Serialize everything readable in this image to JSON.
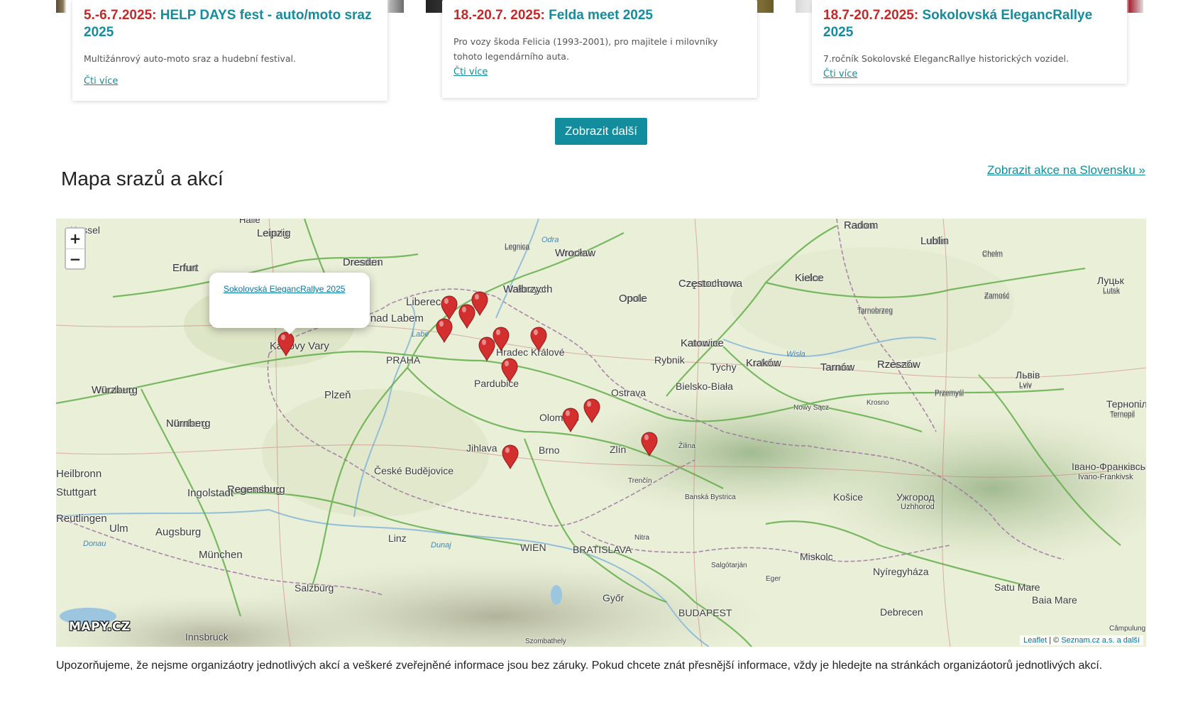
{
  "cards": [
    {
      "date": "5.-6.7.2025:",
      "name": "HELP DAYS fest - auto/moto sraz 2025",
      "desc": "Multižánrový auto-moto sraz a hudební festival.",
      "more": "Čti více"
    },
    {
      "date": "18.-20.7. 2025:",
      "name": "Felda meet 2025",
      "desc": "Pro vozy škoda Felicia (1993-2001), pro majitele i milovníky tohoto legendárního auta.",
      "more": "Čti více"
    },
    {
      "date": "18.7-20.7.2025:",
      "name": "Sokolovská EleganсRallye 2025",
      "desc": "7.ročník Sokolovské EleganсRallye historických vozidel.",
      "more": "Čti více"
    }
  ],
  "more_button": "Zobrazit další",
  "section": {
    "title": "Mapa srazů a akcí",
    "slovakia_link": "Zobrazit akce na Slovensku »"
  },
  "map": {
    "zoom_in": "+",
    "zoom_out": "−",
    "popup_link": "Sokolovská EleganсRallye 2025",
    "attribution_leaflet": "Leaflet",
    "attribution_sep": " | © ",
    "attribution_source": "Seznam.cz a.s. a další",
    "logo": "MAPY.CZ",
    "marker_color": "#d32f2f",
    "road_color": "#5cab43",
    "cities": [
      "Halle",
      "Leipzig",
      "Dresden",
      "Erfurt",
      "Legnica",
      "Wrocław",
      "Wałbrzych",
      "Opole",
      "Częstochowa",
      "Kielce",
      "Radom",
      "Lublin",
      "Chełm",
      "Луцьк",
      "Lutsk",
      "Zamość",
      "Tarnobrzeg",
      "Katowice",
      "Kraków",
      "Tarnów",
      "Rzeszów",
      "Przemyśl",
      "Львів",
      "Lviv",
      "Тернопіль",
      "Ternopil",
      "Würzburg",
      "Nürnberg",
      "Regensburg",
      "Ingolstadt",
      "Augsburg",
      "München",
      "Ulm",
      "Stuttgart",
      "Heilbronn",
      "Reutlingen",
      "Plzeň",
      "Karlovy Vary",
      "PRAHA",
      "Ústí nad Labem",
      "Liberec",
      "Hradec Králové",
      "Pardubice",
      "Jihlava",
      "České Budějovice",
      "Brno",
      "Olomouc",
      "Zlín",
      "Ostrava",
      "Rybnik",
      "Tychy",
      "Bielsko-Biała",
      "Žilina",
      "Trenčín",
      "Banská Bystrica",
      "Nitra",
      "Košice",
      "Ужгород",
      "Uzhhorod",
      "Івано-Франківськ",
      "Ivano-Frankivsk",
      "Nowy Sącz",
      "Krosno",
      "Linz",
      "WIEN",
      "BRATISLAVA",
      "Győr",
      "BUDAPEST",
      "Salzburg",
      "Innsbruck",
      "Szombathely",
      "Miskolc",
      "Eger",
      "Salgótarján",
      "Nyíregyháza",
      "Debrecen",
      "Satu Mare",
      "Baia Mare",
      "Câmpulung",
      "Kassel",
      "Odra",
      "Labe",
      "Wisła",
      "Donau",
      "Dunaj"
    ]
  },
  "disclaimer": "Upozorňujeme, že nejsme organizáotry jednotlivých akcí a veškeré zveřejněné informace jsou bez záruky. Pokud chcete znát přesnější informace, vždy je hledejte na stránkách organizáotorů jednotlivých akcí."
}
